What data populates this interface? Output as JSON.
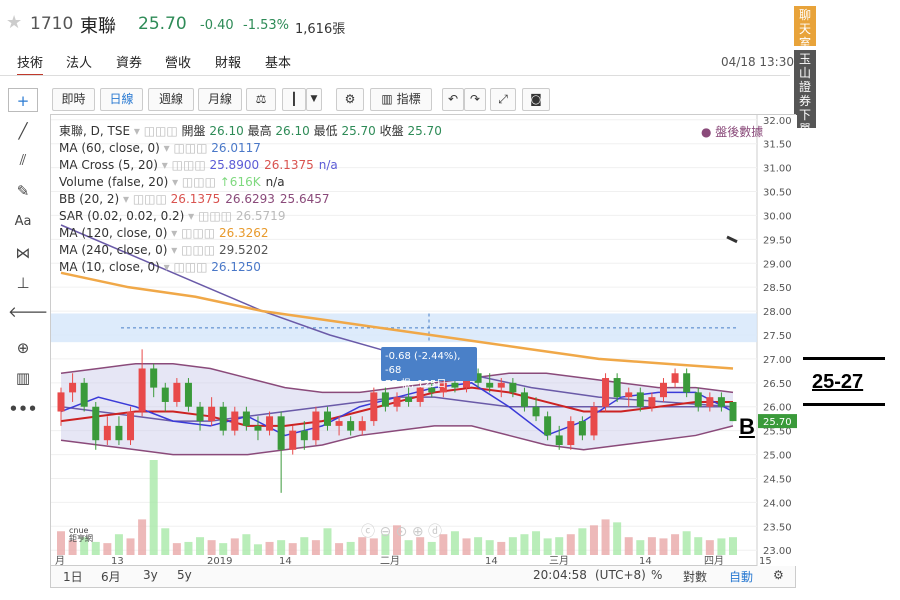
{
  "header": {
    "code": "1710",
    "name": "東聯",
    "price": "25.70",
    "change": "-0.40",
    "change_pct": "-1.53%",
    "volume": "1,616張"
  },
  "tabs": [
    "技術",
    "法人",
    "資券",
    "營收",
    "財報",
    "基本"
  ],
  "datetime": "04/18 13:30",
  "toolbar": {
    "intraday": "即時",
    "daily": "日線",
    "weekly": "週線",
    "monthly": "月線",
    "indicators": "指標"
  },
  "side": {
    "chat": "聊天室",
    "banner": "玉山證券下單"
  },
  "legend": {
    "symbol": "東聯, D, TSE",
    "open_label": "開盤",
    "open": "26.10",
    "high_label": "最高",
    "high": "26.10",
    "low_label": "最低",
    "low": "25.70",
    "close_label": "收盤",
    "close": "25.70",
    "after_hours": "盤後數據",
    "rows": [
      {
        "label": "MA (60, close, 0)",
        "values": [
          "26.0117"
        ],
        "colors": [
          "#4a78c8"
        ]
      },
      {
        "label": "MA Cross (5, 20)",
        "values": [
          "25.8900",
          "26.1375",
          "n/a"
        ],
        "colors": [
          "#5b5bd6",
          "#d9534f",
          "#5b5bd6"
        ]
      },
      {
        "label": "Volume (false, 20)",
        "values": [
          "↑616K",
          "n/a"
        ],
        "colors": [
          "#7fd97f",
          "#333"
        ]
      },
      {
        "label": "BB (20, 2)",
        "values": [
          "26.1375",
          "26.6293",
          "25.6457"
        ],
        "colors": [
          "#d9534f",
          "#8a4a7a",
          "#8a4a7a"
        ]
      },
      {
        "label": "SAR (0.02, 0.02, 0.2)",
        "values": [
          "26.5719"
        ],
        "colors": [
          "#bbb"
        ]
      },
      {
        "label": "MA (120, close, 0)",
        "values": [
          "26.3262"
        ],
        "colors": [
          "#e89a2c"
        ]
      },
      {
        "label": "MA (240, close, 0)",
        "values": [
          "29.5202"
        ],
        "colors": [
          "#555"
        ]
      },
      {
        "label": "MA (10, close, 0)",
        "values": [
          "26.1250"
        ],
        "colors": [
          "#4a78c8"
        ]
      }
    ]
  },
  "tooltip": {
    "line1": "-0.68 (-2.44%), -68",
    "line2": "77 根, 125日"
  },
  "last_price_tag": "25.70",
  "bottom": {
    "range_1d": "1日",
    "range_6m": "6月",
    "range_3y": "3y",
    "range_5y": "5y",
    "time": "20:04:58",
    "tz": "(UTC+8)",
    "pct": "%",
    "log": "對數",
    "auto": "自動"
  },
  "annotation": {
    "range": "25-27",
    "marker": "B"
  },
  "chart_data": {
    "type": "candlestick",
    "y_ticks": [
      "32.00",
      "31.50",
      "31.00",
      "30.50",
      "30.00",
      "29.50",
      "29.00",
      "28.50",
      "28.00",
      "27.50",
      "27.00",
      "26.50",
      "26.00",
      "25.50",
      "25.00",
      "24.50",
      "24.00",
      "23.50",
      "23.00"
    ],
    "ylim": [
      22.9,
      32.1
    ],
    "x_ticks": [
      "月",
      "13",
      "2019",
      "14",
      "二月",
      "14",
      "三月",
      "14",
      "四月",
      "15"
    ],
    "ohlc": [
      [
        25.9,
        26.4,
        25.6,
        26.3
      ],
      [
        26.3,
        26.7,
        26.1,
        26.5
      ],
      [
        26.5,
        26.6,
        25.9,
        26.0
      ],
      [
        26.0,
        26.1,
        25.1,
        25.3
      ],
      [
        25.3,
        25.8,
        25.2,
        25.6
      ],
      [
        25.6,
        25.8,
        25.2,
        25.3
      ],
      [
        25.3,
        26.0,
        25.2,
        25.9
      ],
      [
        25.9,
        27.2,
        25.8,
        26.8
      ],
      [
        26.8,
        26.9,
        26.2,
        26.4
      ],
      [
        26.4,
        26.5,
        25.9,
        26.1
      ],
      [
        26.1,
        26.6,
        26.0,
        26.5
      ],
      [
        26.5,
        26.6,
        25.9,
        26.0
      ],
      [
        26.0,
        26.1,
        25.5,
        25.7
      ],
      [
        25.7,
        26.2,
        25.6,
        26.0
      ],
      [
        26.0,
        26.1,
        25.4,
        25.5
      ],
      [
        25.5,
        26.0,
        25.4,
        25.9
      ],
      [
        25.9,
        26.0,
        25.5,
        25.6
      ],
      [
        25.6,
        25.8,
        25.3,
        25.5
      ],
      [
        25.5,
        25.9,
        25.4,
        25.8
      ],
      [
        25.8,
        25.9,
        24.2,
        25.1
      ],
      [
        25.1,
        25.6,
        25.0,
        25.5
      ],
      [
        25.5,
        25.7,
        25.1,
        25.3
      ],
      [
        25.3,
        26.0,
        25.2,
        25.9
      ],
      [
        25.9,
        26.0,
        25.5,
        25.6
      ],
      [
        25.6,
        25.8,
        25.4,
        25.7
      ],
      [
        25.7,
        25.8,
        25.4,
        25.5
      ],
      [
        25.5,
        25.8,
        25.4,
        25.7
      ],
      [
        25.7,
        26.4,
        25.6,
        26.3
      ],
      [
        26.3,
        26.4,
        25.9,
        26.0
      ],
      [
        26.0,
        26.3,
        25.9,
        26.2
      ],
      [
        26.2,
        26.4,
        26.0,
        26.1
      ],
      [
        26.1,
        26.5,
        26.0,
        26.4
      ],
      [
        26.4,
        26.6,
        26.2,
        26.3
      ],
      [
        26.3,
        26.6,
        26.2,
        26.5
      ],
      [
        26.5,
        26.7,
        26.3,
        26.4
      ],
      [
        26.4,
        26.8,
        26.3,
        26.7
      ],
      [
        26.7,
        26.8,
        26.4,
        26.5
      ],
      [
        26.5,
        26.7,
        26.3,
        26.4
      ],
      [
        26.4,
        26.6,
        26.2,
        26.5
      ],
      [
        26.5,
        26.6,
        26.2,
        26.3
      ],
      [
        26.3,
        26.4,
        25.9,
        26.0
      ],
      [
        26.0,
        26.2,
        25.7,
        25.8
      ],
      [
        25.8,
        25.9,
        25.3,
        25.4
      ],
      [
        25.4,
        25.6,
        25.1,
        25.2
      ],
      [
        25.2,
        25.8,
        25.1,
        25.7
      ],
      [
        25.7,
        25.8,
        25.3,
        25.4
      ],
      [
        25.4,
        26.1,
        25.3,
        26.0
      ],
      [
        26.0,
        26.7,
        25.9,
        26.6
      ],
      [
        26.6,
        26.7,
        26.1,
        26.2
      ],
      [
        26.2,
        26.4,
        26.0,
        26.3
      ],
      [
        26.3,
        26.4,
        25.9,
        26.0
      ],
      [
        26.0,
        26.3,
        25.9,
        26.2
      ],
      [
        26.2,
        26.6,
        26.1,
        26.5
      ],
      [
        26.5,
        26.8,
        26.4,
        26.7
      ],
      [
        26.7,
        26.8,
        26.2,
        26.3
      ],
      [
        26.3,
        26.4,
        25.9,
        26.0
      ],
      [
        26.0,
        26.3,
        25.9,
        26.2
      ],
      [
        26.2,
        26.3,
        25.9,
        26.0
      ],
      [
        26.1,
        26.1,
        25.7,
        25.7
      ]
    ],
    "bb_upper": [
      26.7,
      26.8,
      26.9,
      26.9,
      26.8,
      26.6,
      26.4,
      26.3,
      26.3,
      26.4,
      26.5,
      26.6,
      26.7,
      26.7,
      26.6,
      26.5,
      26.4,
      26.4,
      26.3
    ],
    "bb_lower": [
      25.3,
      25.2,
      25.1,
      25.0,
      25.0,
      25.0,
      25.1,
      25.2,
      25.4,
      25.5,
      25.6,
      25.6,
      25.4,
      25.2,
      25.1,
      25.2,
      25.3,
      25.4,
      25.6
    ],
    "ma60": [
      26.0,
      25.9,
      25.8,
      25.7,
      25.7,
      25.8,
      25.9,
      26.0,
      26.1,
      26.2,
      26.2,
      26.1,
      26.0,
      26.0,
      26.0,
      26.0,
      26.0,
      26.0,
      26.0
    ],
    "ma20": [
      25.7,
      25.8,
      25.9,
      25.9,
      25.8,
      25.6,
      25.6,
      25.7,
      25.9,
      26.1,
      26.3,
      26.4,
      26.3,
      26.1,
      25.9,
      25.9,
      26.0,
      26.1,
      26.1
    ],
    "ma5": [
      25.9,
      26.2,
      26.0,
      25.7,
      25.6,
      25.8,
      25.4,
      25.6,
      26.0,
      26.2,
      26.4,
      26.5,
      26.0,
      25.4,
      25.7,
      26.2,
      26.3,
      26.3,
      25.9
    ],
    "ma120": [
      28.8,
      28.5,
      28.3,
      28.0,
      27.8,
      27.6,
      27.4,
      27.2,
      27.0,
      26.9,
      26.8
    ],
    "ma240": [
      29.8,
      29.2,
      28.6,
      28.0,
      27.5,
      27.1,
      26.7,
      26.4,
      26.2,
      26.1,
      26.0
    ],
    "volume": [
      40,
      25,
      30,
      22,
      20,
      35,
      28,
      60,
      160,
      45,
      20,
      22,
      30,
      25,
      20,
      28,
      35,
      18,
      22,
      25,
      20,
      30,
      25,
      45,
      20,
      22,
      30,
      28,
      35,
      50,
      25,
      30,
      22,
      35,
      40,
      28,
      30,
      25,
      22,
      30,
      35,
      40,
      28,
      30,
      35,
      45,
      50,
      60,
      55,
      30,
      25,
      30,
      28,
      35,
      40,
      30,
      25,
      28,
      30
    ]
  }
}
